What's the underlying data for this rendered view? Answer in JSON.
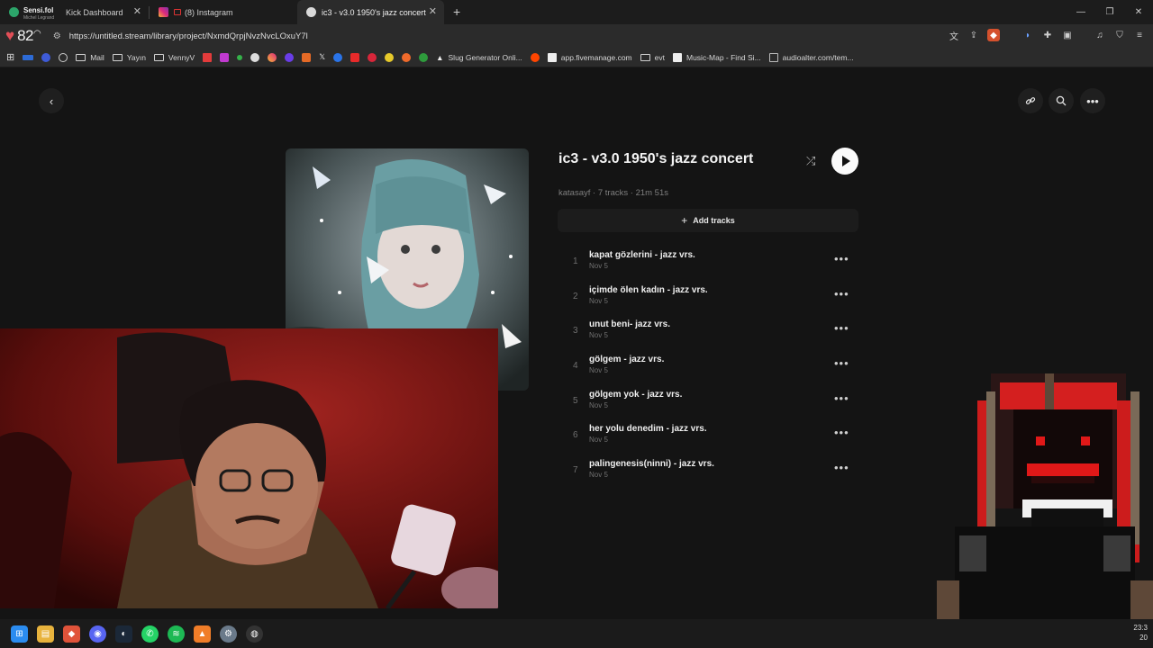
{
  "tabs": [
    {
      "title": "Kick Dashboard",
      "overlay": "Sensi.fol",
      "sub": "Michel Legrand",
      "active": false
    },
    {
      "title": "(8) Instagram",
      "active": false
    },
    {
      "title": "ic3 - v3.0 1950's jazz concert",
      "active": true
    }
  ],
  "browser": {
    "weather_temp": "82",
    "url": "https://untitled.stream/library/project/NxmdQrpjNvzNvcLOxuY7l"
  },
  "bookmarks": [
    {
      "label": "Mail",
      "type": "folder"
    },
    {
      "label": "Yayın",
      "type": "folder"
    },
    {
      "label": "VennyV",
      "type": "folder"
    },
    {
      "label": "Slug Generator Onli...",
      "type": "site"
    },
    {
      "label": "app.fivemanage.com",
      "type": "site"
    },
    {
      "label": "evt",
      "type": "folder"
    },
    {
      "label": "Music-Map - Find Si...",
      "type": "site"
    },
    {
      "label": "audioalter.com/tem...",
      "type": "site"
    }
  ],
  "project": {
    "title": "ic3 - v3.0 1950's jazz concert",
    "owner": "katasayf",
    "track_count": "7 tracks",
    "duration": "21m 51s",
    "add_tracks_label": "Add tracks"
  },
  "tracks": [
    {
      "num": "1",
      "name": "kapat gözlerini - jazz vrs.",
      "date": "Nov 5"
    },
    {
      "num": "2",
      "name": "içimde ölen kadın - jazz vrs.",
      "date": "Nov 5"
    },
    {
      "num": "3",
      "name": "unut beni- jazz vrs.",
      "date": "Nov 5"
    },
    {
      "num": "4",
      "name": "gölgem - jazz vrs.",
      "date": "Nov 5"
    },
    {
      "num": "5",
      "name": "gölgem yok - jazz vrs.",
      "date": "Nov 5"
    },
    {
      "num": "6",
      "name": "her yolu denedim - jazz vrs.",
      "date": "Nov 5"
    },
    {
      "num": "7",
      "name": "palingenesis(ninni) - jazz vrs.",
      "date": "Nov 5"
    }
  ],
  "taskbar": {
    "clock_time": "23:3",
    "clock_date": "20"
  },
  "colors": {
    "background": "#141414",
    "accent_heart": "#e14e57",
    "play_button": "#fafafa"
  }
}
